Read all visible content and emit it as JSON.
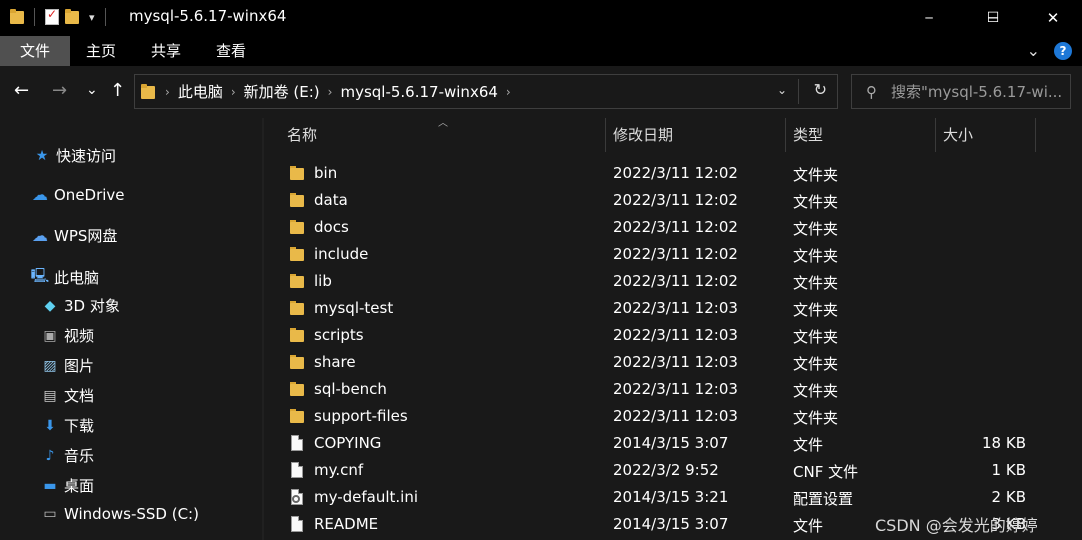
{
  "window": {
    "title": "mysql-5.6.17-winx64",
    "controls": {
      "minimize": "─",
      "maximize": "☐",
      "close": "✕"
    }
  },
  "ribbon": {
    "tabs": [
      "文件",
      "主页",
      "共享",
      "查看"
    ],
    "expand_glyph": "⌄",
    "help_glyph": "?"
  },
  "nav": {
    "back": "←",
    "forward": "→",
    "recent": "⌄",
    "up": "↑",
    "breadcrumbs": [
      "此电脑",
      "新加卷 (E:)",
      "mysql-5.6.17-winx64"
    ],
    "dropdown": "⌄",
    "refresh": "↻",
    "search_placeholder": "搜索\"mysql-5.6.17-wi..."
  },
  "sidebar": {
    "items": [
      {
        "label": "快速访问",
        "icon": "star-icon"
      },
      {
        "label": "OneDrive",
        "icon": "cloud-icon"
      },
      {
        "label": "WPS网盘",
        "icon": "wps-cloud-icon"
      },
      {
        "label": "此电脑",
        "icon": "computer-icon"
      },
      {
        "label": "3D 对象",
        "icon": "cube-icon"
      },
      {
        "label": "视频",
        "icon": "video-icon"
      },
      {
        "label": "图片",
        "icon": "picture-icon"
      },
      {
        "label": "文档",
        "icon": "document-icon"
      },
      {
        "label": "下载",
        "icon": "download-icon"
      },
      {
        "label": "音乐",
        "icon": "music-icon"
      },
      {
        "label": "桌面",
        "icon": "desktop-icon"
      },
      {
        "label": "Windows-SSD (C:)",
        "icon": "drive-icon"
      }
    ]
  },
  "columns": {
    "name": "名称",
    "modified": "修改日期",
    "type": "类型",
    "size": "大小"
  },
  "files": [
    {
      "name": "bin",
      "modified": "2022/3/11 12:02",
      "type": "文件夹",
      "size": "",
      "kind": "folder"
    },
    {
      "name": "data",
      "modified": "2022/3/11 12:02",
      "type": "文件夹",
      "size": "",
      "kind": "folder"
    },
    {
      "name": "docs",
      "modified": "2022/3/11 12:02",
      "type": "文件夹",
      "size": "",
      "kind": "folder"
    },
    {
      "name": "include",
      "modified": "2022/3/11 12:02",
      "type": "文件夹",
      "size": "",
      "kind": "folder"
    },
    {
      "name": "lib",
      "modified": "2022/3/11 12:02",
      "type": "文件夹",
      "size": "",
      "kind": "folder"
    },
    {
      "name": "mysql-test",
      "modified": "2022/3/11 12:03",
      "type": "文件夹",
      "size": "",
      "kind": "folder"
    },
    {
      "name": "scripts",
      "modified": "2022/3/11 12:03",
      "type": "文件夹",
      "size": "",
      "kind": "folder"
    },
    {
      "name": "share",
      "modified": "2022/3/11 12:03",
      "type": "文件夹",
      "size": "",
      "kind": "folder"
    },
    {
      "name": "sql-bench",
      "modified": "2022/3/11 12:03",
      "type": "文件夹",
      "size": "",
      "kind": "folder"
    },
    {
      "name": "support-files",
      "modified": "2022/3/11 12:03",
      "type": "文件夹",
      "size": "",
      "kind": "folder"
    },
    {
      "name": "COPYING",
      "modified": "2014/3/15 3:07",
      "type": "文件",
      "size": "18 KB",
      "kind": "file"
    },
    {
      "name": "my.cnf",
      "modified": "2022/3/2 9:52",
      "type": "CNF 文件",
      "size": "1 KB",
      "kind": "file"
    },
    {
      "name": "my-default.ini",
      "modified": "2014/3/15 3:21",
      "type": "配置设置",
      "size": "2 KB",
      "kind": "ini"
    },
    {
      "name": "README",
      "modified": "2014/3/15 3:07",
      "type": "文件",
      "size": "3 KB",
      "kind": "file"
    }
  ],
  "watermark": "CSDN @会发光的婷婷",
  "colors": {
    "background": "#191919",
    "titlebar": "#000000",
    "folder": "#e9b949",
    "accent": "#1e78d7"
  }
}
